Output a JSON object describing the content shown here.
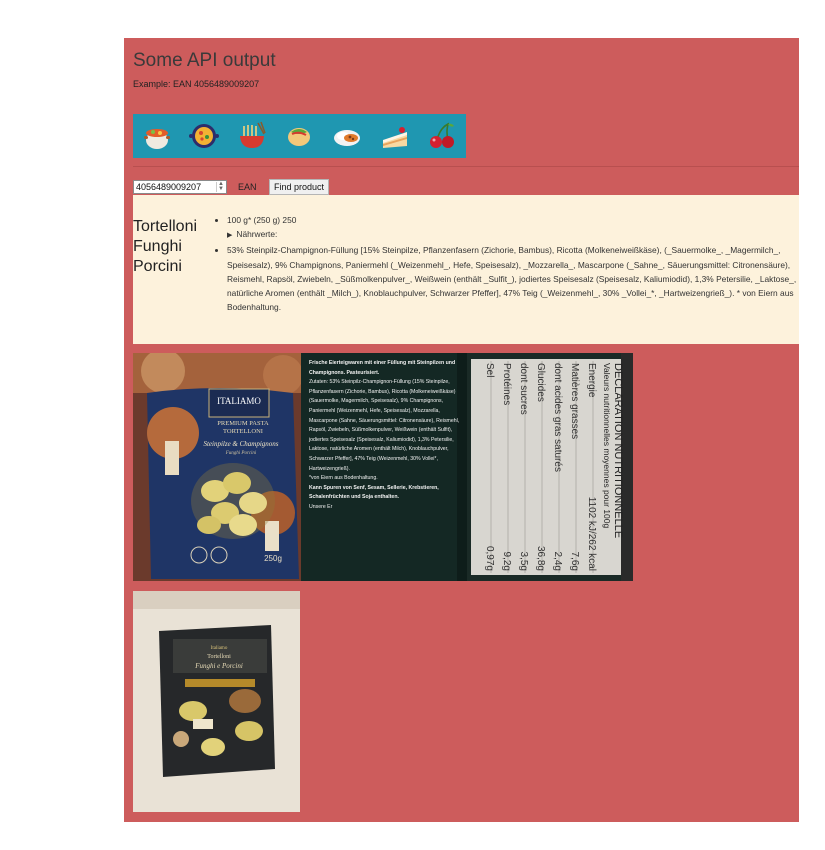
{
  "header": {
    "title": "Some API output",
    "subtitle": "Example: EAN 4056489009207"
  },
  "icons": [
    "pot-of-food-icon",
    "paella-pan-icon",
    "noodle-bowl-icon",
    "burrito-icon",
    "curry-rice-icon",
    "cake-slice-icon",
    "cherries-icon"
  ],
  "search": {
    "value": "4056489009207",
    "type_label": "EAN",
    "button_label": "Find product"
  },
  "product": {
    "name": "Tortelloni Funghi Porcini",
    "quantity": "100 g* (250 g) 250",
    "summary_label": "Nährwerte:",
    "ingredients": "53% Steinpilz-Champignon-Füllung [15% Steinpilze, Pflanzenfasern (Zichorie, Bambus), Ricotta (Molkeneiweißkäse), (_Sauermolke_, _Magermilch_, Speisesalz), 9% Champignons, Paniermehl (_Weizenmehl_, Hefe, Speisesalz), _Mozzarella_, Mascarpone (_Sahne_, Säuerungsmittel: Citronensäure), Reismehl, Rapsöl, Zwiebeln, _Süßmolkenpulver_, Weißwein (enthält _Sulfit_), jodiertes Speisesalz (Speisesalz, Kaliumiodid), 1,3% Petersilie, _Laktose_, natürliche Aromen (enthält _Milch_), Knoblauchpulver, Schwarzer Pfeffer], 47% Teig (_Weizenmehl_, 30% _Vollei_*, _Hartweizengrieß_). * von Eiern aus Bodenhaltung."
  },
  "photos": {
    "front": {
      "brand": "ITALIAMO",
      "line": "PREMIUM PASTA",
      "product": "TORTELLONI",
      "variety": "Steinpilze & Champignons",
      "variety_it": "Funghi Porcini",
      "weight": "250g"
    },
    "ingredients": {
      "intro": "Frische Eierteigwaren mit einer Füllung mit Steinpilzen und Champignons. Pasteurisiert.",
      "zutaten": "Zutaten: 53% Steinpilz-Champignon-Füllung (15% Steinpilze, Pflanzenfasern (Zichorie, Bambus), Ricotta (Molkeneiweißkäse) (Sauermolke, Magermilch, Speisesalz), 9% Champignons, Paniermehl (Weizenmehl, Hefe, Speisesalz), Mozzarella, Mascarpone (Sahne, Säuerungsmittel: Citronensäure), Reismehl, Rapsöl, Zwiebeln, Süßmolkenpulver, Weißwein (enthält Sulfit), jodiertes Speisesalz (Speisesalz, Kaliumiodid), 1,3% Petersilie, Laktose, natürliche Aromen (enthält Milch), Knoblauchpulver, Schwarzer Pfeffer], 47% Teig (Weizenmehl, 30% Vollei*, Hartweizengrieß).",
      "note": "*von Eiern aus Bodenhaltung.",
      "traces": "Kann Spuren von Senf, Sesam, Sellerie, Krebstieren, Schalenfrüchten und Soja enthalten.",
      "tail": "Unsere Er"
    },
    "nutrition": {
      "heading": "DECLARATION NUTRITIONNELLE",
      "subheading": "Valeurs nutritionnelles moyennes pour 100g",
      "rows": [
        {
          "label": "Energie",
          "value": "1102 kJ/262 kcal"
        },
        {
          "label": "Matières grasses",
          "value": "7,6g"
        },
        {
          "label": "dont acides gras saturés",
          "value": "2,4g"
        },
        {
          "label": "Glucides",
          "value": "36,8g"
        },
        {
          "label": "dont sucres",
          "value": "3,5g"
        },
        {
          "label": "Protéines",
          "value": "9,2g"
        },
        {
          "label": "Sel",
          "value": "0,97g"
        }
      ]
    },
    "pack": {
      "brand": "Italiamo",
      "product": "Tortelloni",
      "variety": "Funghi e Porcini"
    }
  },
  "colors": {
    "panel": "#cd5c5c",
    "icon_strip": "#1f97b1",
    "product_card": "#fdf2dc"
  }
}
